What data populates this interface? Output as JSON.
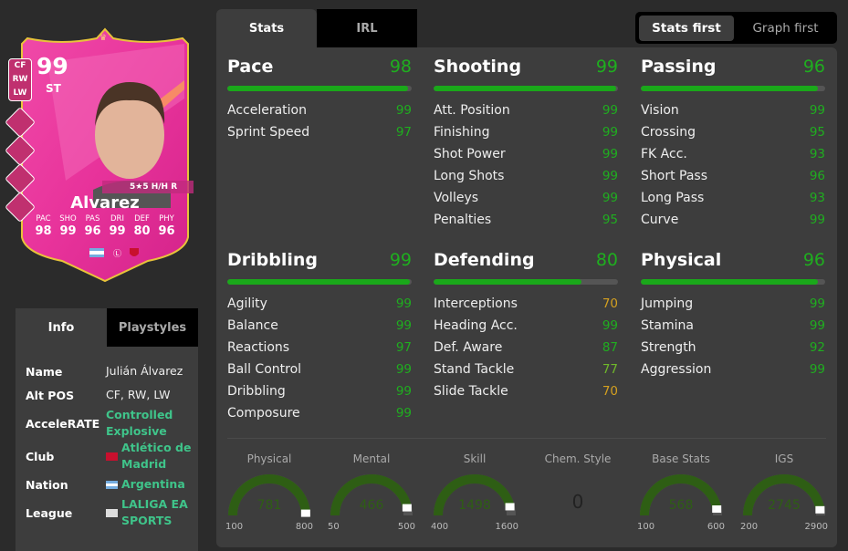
{
  "card": {
    "rating": "99",
    "position": "ST",
    "alt_positions": [
      "CF",
      "RW",
      "LW"
    ],
    "skills_weakfoot": "5★5 H/H R",
    "name": "Alvarez",
    "stat_labels": [
      "PAC",
      "SHO",
      "PAS",
      "DRI",
      "DEF",
      "PHY"
    ],
    "stat_values": [
      "98",
      "99",
      "96",
      "99",
      "80",
      "96"
    ],
    "playstyle_icons": [
      "finesse-shot-icon",
      "press-proven-icon",
      "power-shot-icon",
      "first-touch-icon"
    ],
    "card_color": "#e8339b"
  },
  "tabs": {
    "stats": "Stats",
    "irl": "IRL"
  },
  "toggle": {
    "stats_first": "Stats first",
    "graph_first": "Graph first"
  },
  "categories": [
    {
      "name": "Pace",
      "value": "98",
      "rows": [
        [
          "Acceleration",
          "99"
        ],
        [
          "Sprint Speed",
          "97"
        ]
      ]
    },
    {
      "name": "Shooting",
      "value": "99",
      "rows": [
        [
          "Att. Position",
          "99"
        ],
        [
          "Finishing",
          "99"
        ],
        [
          "Shot Power",
          "99"
        ],
        [
          "Long Shots",
          "99"
        ],
        [
          "Volleys",
          "99"
        ],
        [
          "Penalties",
          "95"
        ]
      ]
    },
    {
      "name": "Passing",
      "value": "96",
      "rows": [
        [
          "Vision",
          "99"
        ],
        [
          "Crossing",
          "95"
        ],
        [
          "FK Acc.",
          "93"
        ],
        [
          "Short Pass",
          "96"
        ],
        [
          "Long Pass",
          "93"
        ],
        [
          "Curve",
          "99"
        ]
      ]
    },
    {
      "name": "Dribbling",
      "value": "99",
      "rows": [
        [
          "Agility",
          "99"
        ],
        [
          "Balance",
          "99"
        ],
        [
          "Reactions",
          "97"
        ],
        [
          "Ball Control",
          "99"
        ],
        [
          "Dribbling",
          "99"
        ],
        [
          "Composure",
          "99"
        ]
      ]
    },
    {
      "name": "Defending",
      "value": "80",
      "rows": [
        [
          "Interceptions",
          "70"
        ],
        [
          "Heading Acc.",
          "99"
        ],
        [
          "Def. Aware",
          "87"
        ],
        [
          "Stand Tackle",
          "77"
        ],
        [
          "Slide Tackle",
          "70"
        ]
      ]
    },
    {
      "name": "Physical",
      "value": "96",
      "rows": [
        [
          "Jumping",
          "99"
        ],
        [
          "Stamina",
          "99"
        ],
        [
          "Strength",
          "92"
        ],
        [
          "Aggression",
          "99"
        ]
      ]
    }
  ],
  "gauges": [
    {
      "label": "Physical",
      "value": "781",
      "min": "100",
      "max": "800"
    },
    {
      "label": "Mental",
      "value": "466",
      "min": "50",
      "max": "500"
    },
    {
      "label": "Skill",
      "value": "1498",
      "min": "400",
      "max": "1600"
    },
    {
      "label": "Chem. Style",
      "value": "0"
    },
    {
      "label": "Base Stats",
      "value": "568",
      "min": "100",
      "max": "600"
    },
    {
      "label": "IGS",
      "value": "2745",
      "min": "200",
      "max": "2900"
    }
  ],
  "info": {
    "tabs": {
      "info": "Info",
      "playstyles": "Playstyles"
    },
    "rows": [
      {
        "key": "Name",
        "value": "Julián Álvarez"
      },
      {
        "key": "Alt POS",
        "value": "CF, RW, LW"
      },
      {
        "key": "AcceleRATE",
        "value": "Controlled Explosive"
      },
      {
        "key": "Club",
        "value": "Atlético de Madrid",
        "icon": "club-crest-icon"
      },
      {
        "key": "Nation",
        "value": "Argentina",
        "icon": "argentina-flag-icon"
      },
      {
        "key": "League",
        "value": "LALIGA EA SPORTS",
        "icon": "laliga-logo-icon"
      }
    ]
  },
  "colors": {
    "high": "#1fae1f",
    "mid": "#6fb82a",
    "low": "#d4a020",
    "gauge": "#2e5e14"
  }
}
